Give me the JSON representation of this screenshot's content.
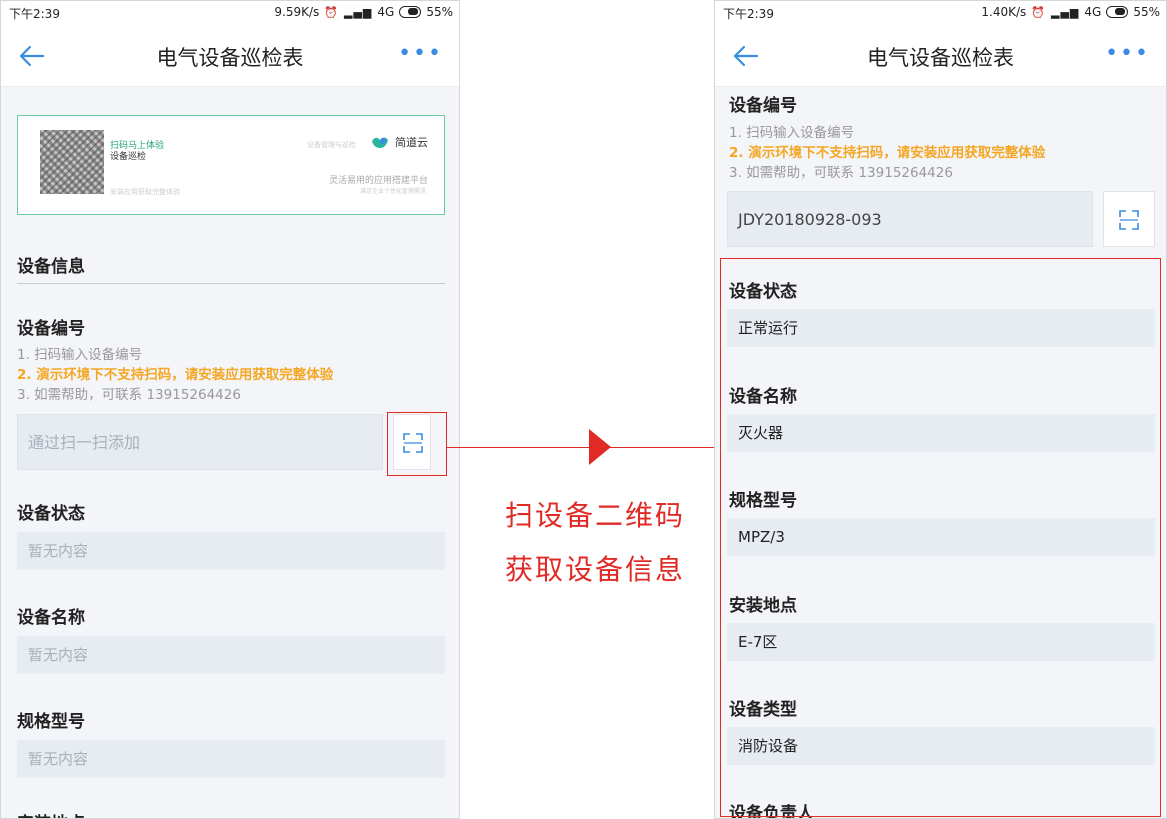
{
  "left_screen": {
    "status": {
      "time": "下午2:39",
      "speed": "9.59K/s",
      "network": "4G",
      "battery": "55%"
    },
    "nav": {
      "title": "电气设备巡检表",
      "more": "•••"
    },
    "banner": {
      "title": "扫码马上体验",
      "subtitle": "设备巡检",
      "install_text": "安装应用获取完整体验",
      "tagline_top": "设备管理与巡检",
      "brand": "简道云",
      "tagline": "灵活易用的应用搭建平台",
      "tagline_small": "满足企业个性化管理需求"
    },
    "section_title": "设备信息",
    "device_no": {
      "label": "设备编号",
      "hint1": "1. 扫码输入设备编号",
      "hint2": "2. 演示环境下不支持扫码，请安装应用获取完整体验",
      "hint3": "3. 如需帮助，可联系 13915264426",
      "placeholder": "通过扫一扫添加"
    },
    "fields": [
      {
        "label": "设备状态",
        "value": "暂无内容"
      },
      {
        "label": "设备名称",
        "value": "暂无内容"
      },
      {
        "label": "规格型号",
        "value": "暂无内容"
      }
    ],
    "cut_label": "安装地点"
  },
  "annotation": {
    "line1": "扫设备二维码",
    "line2": "获取设备信息",
    "color": "#e02a25"
  },
  "right_screen": {
    "status": {
      "time": "下午2:39",
      "speed": "1.40K/s",
      "network": "4G",
      "battery": "55%"
    },
    "nav": {
      "title": "电气设备巡检表",
      "more": "•••"
    },
    "device_no": {
      "label": "设备编号",
      "hint1": "1. 扫码输入设备编号",
      "hint2": "2. 演示环境下不支持扫码，请安装应用获取完整体验",
      "hint3": "3. 如需帮助，可联系 13915264426",
      "value": "JDY20180928-093"
    },
    "fields": [
      {
        "label": "设备状态",
        "value": "正常运行"
      },
      {
        "label": "设备名称",
        "value": "灭火器"
      },
      {
        "label": "规格型号",
        "value": "MPZ/3"
      },
      {
        "label": "安装地点",
        "value": "E-7区"
      },
      {
        "label": "设备类型",
        "value": "消防设备"
      }
    ],
    "cut_label": "设备负责人"
  },
  "colors": {
    "accent": "#3a8be3",
    "warning": "#f5a623",
    "highlight": "#e02a25",
    "field_bg": "#e7ebf2",
    "banner_border": "#70c9a6"
  }
}
